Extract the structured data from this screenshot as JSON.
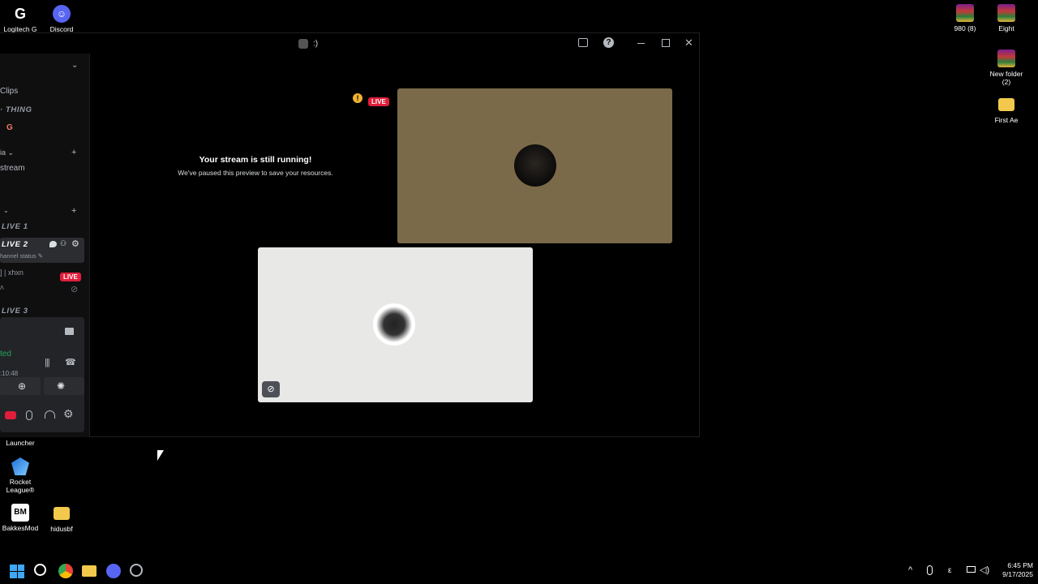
{
  "desktop": {
    "icons_left": [
      {
        "label": "Logitech G HUB",
        "icon": "logitech-g-icon"
      },
      {
        "label": "Discord",
        "icon": "discord-icon"
      },
      {
        "label": "Launcher",
        "icon": "launcher-icon"
      },
      {
        "label": "Rocket League®",
        "icon": "rocket-league-icon"
      },
      {
        "label": "BakkesMod",
        "icon": "bakkesmod-icon"
      },
      {
        "label": "hidusbf",
        "icon": "folder-icon"
      }
    ],
    "icons_right": [
      {
        "label": "980 (8)",
        "icon": "rar-archive-icon"
      },
      {
        "label": "Eight",
        "icon": "rar-archive-icon"
      },
      {
        "label": "New folder (2)",
        "icon": "rar-archive-icon"
      },
      {
        "label": "First Ae",
        "icon": "folder-icon"
      }
    ]
  },
  "window": {
    "title": ":)",
    "controls": [
      "inbox-icon",
      "help-icon",
      "minimize-icon",
      "maximize-icon",
      "close-icon"
    ]
  },
  "sidebar": {
    "clips_label": "Clips",
    "category_thing": "THING",
    "category_media": "ia",
    "stream_channel": "stream",
    "voice_channels": [
      "LIVE 1",
      "LIVE 2",
      "LIVE 3"
    ],
    "channel_status_placeholder": "hannel status",
    "live_user": "] | xhxn",
    "live_badge": "LIVE",
    "voice_connected": "ted",
    "call_timer": ":10:48"
  },
  "stage": {
    "paused_title": "Your stream is still running!",
    "paused_subtitle": "We've paused this preview to save your resources.",
    "live_badge": "LIVE",
    "warning_icon": "warning-icon"
  },
  "taskbar": {
    "apps": [
      "windows-start-icon",
      "search-icon",
      "chrome-icon",
      "file-explorer-icon",
      "discord-icon",
      "steam-icon"
    ],
    "time": "6:45 PM",
    "date": "9/17/2025",
    "tray": [
      "chevron-up-icon",
      "microphone-icon",
      "language-icon",
      "network-icon",
      "volume-icon"
    ],
    "language": "ε"
  },
  "colors": {
    "live_red": "#e01e3c",
    "voice_green": "#23a55a",
    "stream_tile_bg": "#7a6a49",
    "camera_tile_bg": "#e8e8e6",
    "warning_yellow": "#f0b232"
  }
}
